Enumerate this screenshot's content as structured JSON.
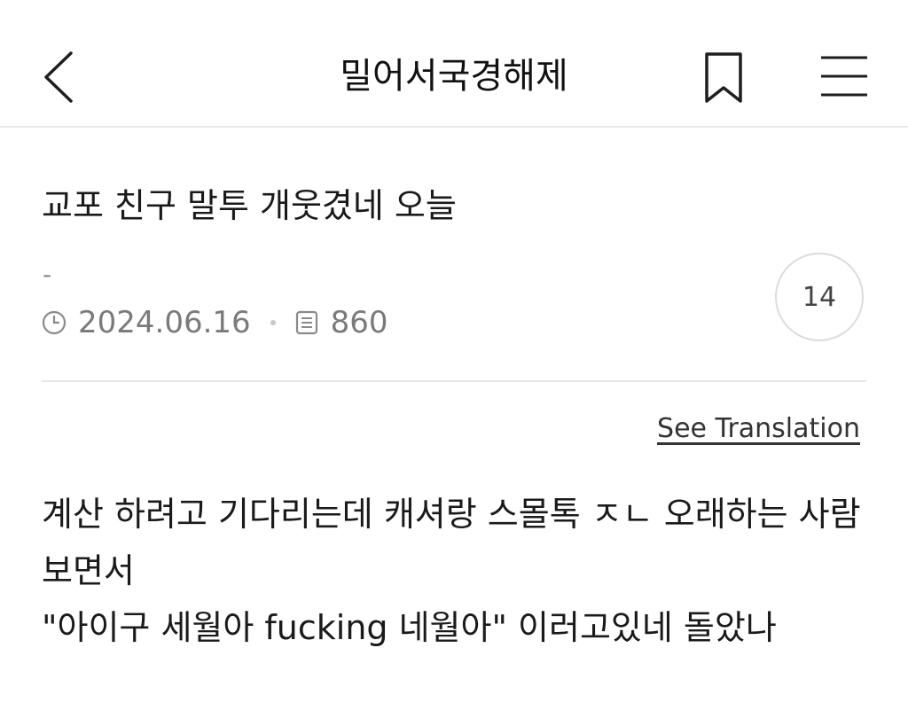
{
  "header": {
    "title": "밀어서국경해제",
    "back_icon": "chevron-left-icon",
    "bookmark_icon": "bookmark-icon",
    "menu_icon": "hamburger-menu-icon"
  },
  "post": {
    "title": "교포 친구 말투 개웃겼네 오늘",
    "author": "-",
    "date": "2024.06.16",
    "views": "860",
    "comment_count": "14",
    "translate_label": "See Translation",
    "body_lines": [
      "계산 하려고 기다리는데 캐셔랑 스몰톡 ㅈㄴ 오래하는 사람 보면서",
      "\"아이구 세월아 fucking 네월아\" 이러고있네 돌았나"
    ]
  }
}
